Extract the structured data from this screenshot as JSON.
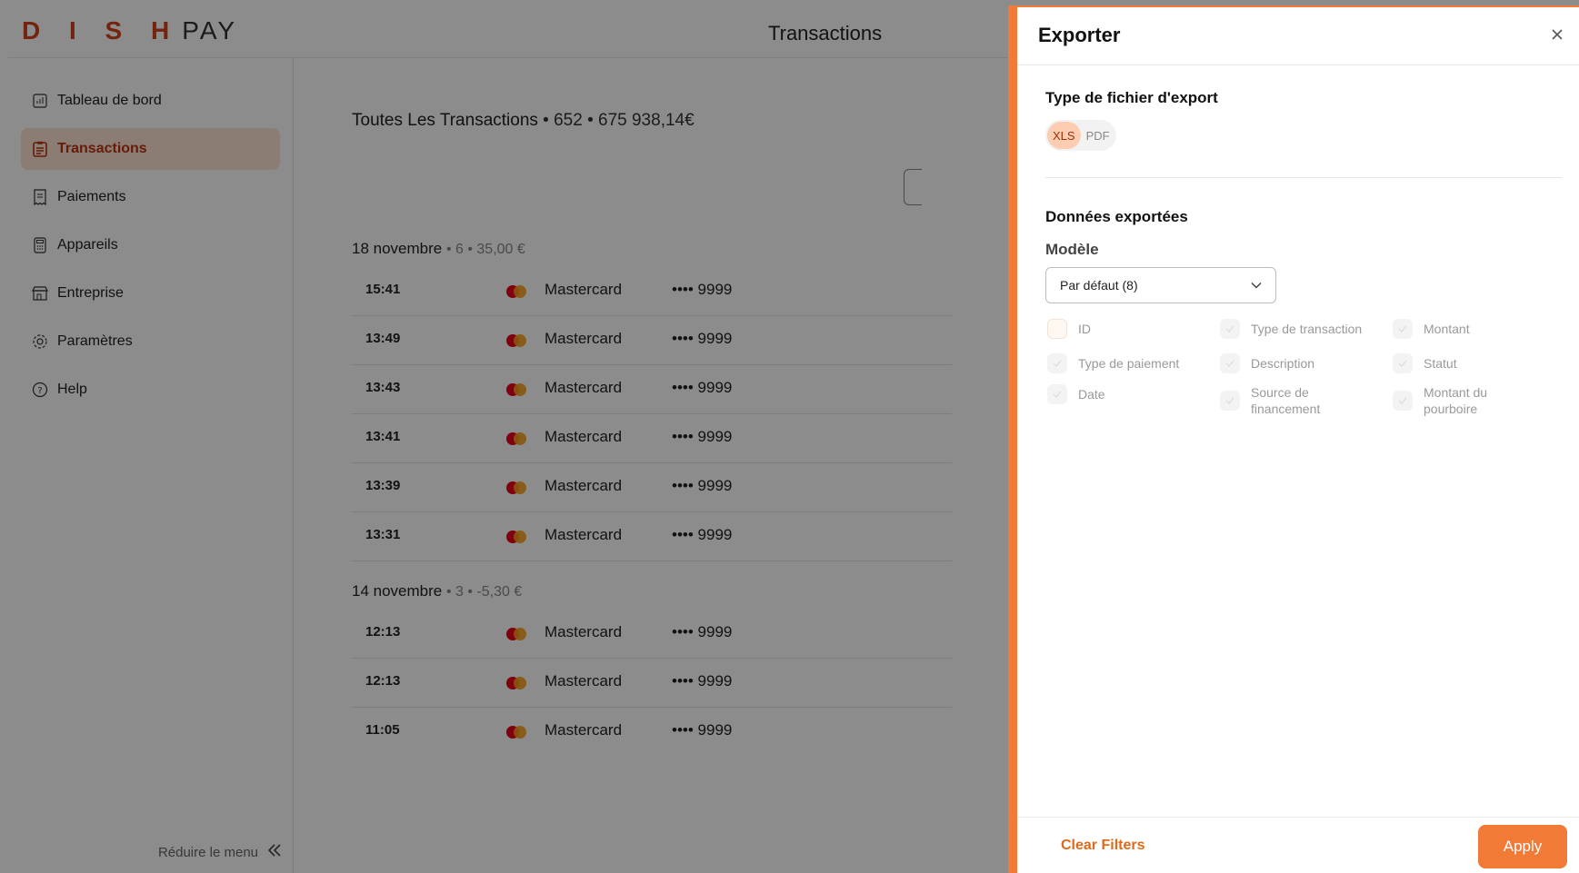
{
  "brand": {
    "logo_primary": "D I S H",
    "logo_secondary": "PAY"
  },
  "header": {
    "title": "Transactions"
  },
  "sidebar": {
    "items": [
      {
        "label": "Tableau de bord",
        "icon": "chart-icon"
      },
      {
        "label": "Transactions",
        "icon": "clipboard-icon",
        "active": true
      },
      {
        "label": "Paiements",
        "icon": "receipt-icon"
      },
      {
        "label": "Appareils",
        "icon": "calculator-icon"
      },
      {
        "label": "Entreprise",
        "icon": "store-icon"
      },
      {
        "label": "Paramètres",
        "icon": "gear-icon"
      },
      {
        "label": "Help",
        "icon": "help-icon"
      }
    ],
    "collapse_label": "Réduire le menu"
  },
  "main": {
    "heading_title": "Toutes Les Transactions",
    "heading_meta": "• 652 • 675 938,14€",
    "groups": [
      {
        "date": "18 novembre",
        "meta": "• 6 • 35,00 €",
        "rows": [
          {
            "time": "15:41",
            "brand": "Mastercard",
            "card": "•••• 9999"
          },
          {
            "time": "13:49",
            "brand": "Mastercard",
            "card": "•••• 9999"
          },
          {
            "time": "13:43",
            "brand": "Mastercard",
            "card": "•••• 9999"
          },
          {
            "time": "13:41",
            "brand": "Mastercard",
            "card": "•••• 9999"
          },
          {
            "time": "13:39",
            "brand": "Mastercard",
            "card": "•••• 9999"
          },
          {
            "time": "13:31",
            "brand": "Mastercard",
            "card": "•••• 9999"
          }
        ]
      },
      {
        "date": "14 novembre",
        "meta": "• 3 • -5,30 €",
        "rows": [
          {
            "time": "12:13",
            "brand": "Mastercard",
            "card": "•••• 9999"
          },
          {
            "time": "12:13",
            "brand": "Mastercard",
            "card": "•••• 9999"
          },
          {
            "time": "11:05",
            "brand": "Mastercard",
            "card": "•••• 9999"
          }
        ]
      }
    ]
  },
  "export_drawer": {
    "title": "Exporter",
    "file_type_label": "Type de fichier d'export",
    "file_types": [
      {
        "label": "XLS",
        "selected": true
      },
      {
        "label": "PDF",
        "selected": false
      }
    ],
    "data_label": "Données exportées",
    "model_label": "Modèle",
    "model_value": "Par défaut (8)",
    "columns": [
      {
        "label": "ID",
        "checked": false
      },
      {
        "label": "Type de transaction",
        "checked": true
      },
      {
        "label": "Montant",
        "checked": true
      },
      {
        "label": "Type de paiement",
        "checked": true
      },
      {
        "label": "Description",
        "checked": true
      },
      {
        "label": "Statut",
        "checked": true
      },
      {
        "label": "Date",
        "checked": true
      },
      {
        "label": "Source de financement",
        "checked": true
      },
      {
        "label": "Montant du pourboire",
        "checked": true
      }
    ],
    "clear_label": "Clear Filters",
    "apply_label": "Apply"
  },
  "colors": {
    "accent": "#f07a36",
    "brand_red": "#d2401a",
    "active_bg": "#fde3d4"
  }
}
